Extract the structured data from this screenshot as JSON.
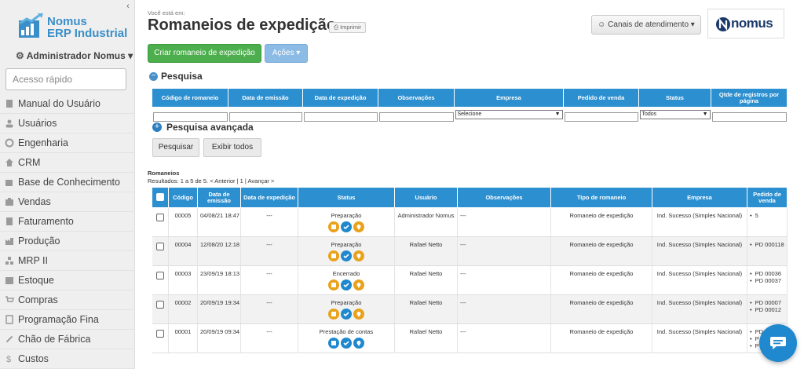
{
  "sidebar": {
    "brand_line1": "Nomus",
    "brand_line2": "ERP Industrial",
    "user_label": "Administrador Nomus",
    "quick_access_placeholder": "Acesso rápido",
    "items": [
      {
        "label": "Manual do Usuário",
        "icon": "book-icon"
      },
      {
        "label": "Usuários",
        "icon": "user-icon"
      },
      {
        "label": "Engenharia",
        "icon": "gear-icon"
      },
      {
        "label": "CRM",
        "icon": "home-icon"
      },
      {
        "label": "Base de Conhecimento",
        "icon": "edit-icon"
      },
      {
        "label": "Vendas",
        "icon": "sales-icon"
      },
      {
        "label": "Faturamento",
        "icon": "invoice-icon"
      },
      {
        "label": "Produção",
        "icon": "factory-icon"
      },
      {
        "label": "MRP II",
        "icon": "network-icon"
      },
      {
        "label": "Estoque",
        "icon": "box-icon"
      },
      {
        "label": "Compras",
        "icon": "cart-icon"
      },
      {
        "label": "Programação Fina",
        "icon": "doc-icon"
      },
      {
        "label": "Chão de Fábrica",
        "icon": "wrench-icon"
      },
      {
        "label": "Custos",
        "icon": "dollar-icon"
      }
    ]
  },
  "header": {
    "breadcrumb": "Você está em:",
    "title": "Romaneios de expedição",
    "print_label": "Imprimir",
    "channels_label": "Canais de atendimento",
    "logo_text": "nomus"
  },
  "toolbar": {
    "create_label": "Criar romaneio de expedição",
    "actions_label": "Ações"
  },
  "search": {
    "section_title": "Pesquisa",
    "columns": [
      "Código de romaneio",
      "Data de emissão",
      "Data de expedição",
      "Observações",
      "Empresa",
      "Pedido de venda",
      "Status",
      "Qtde de registros por página"
    ],
    "empresa_selected": "Selecione",
    "status_selected": "Todos",
    "advanced_label": "Pesquisa avançada",
    "search_button": "Pesquisar",
    "show_all_button": "Exibir todos"
  },
  "results": {
    "title": "Romaneios",
    "info_prefix": "Resultados: 1 a 5 de 5.",
    "prev_label": "< Anterior",
    "page_label": "1",
    "next_label": "Avançar >",
    "columns": [
      "Código",
      "Data de emissão",
      "Data de expedição",
      "Status",
      "Usuário",
      "Observações",
      "Tipo de romaneio",
      "Empresa",
      "Pedido de venda"
    ],
    "rows": [
      {
        "code": "00005",
        "issued": "04/08/21 18:47",
        "shipped": "---",
        "status": "Preparação",
        "user": "Administrador Nomus",
        "notes": "---",
        "type": "Romaneio de expedição",
        "company": "Ind. Sucesso (Simples Nacional)",
        "orders": [
          "5"
        ],
        "icons": [
          "orange",
          "blue",
          "orange"
        ]
      },
      {
        "code": "00004",
        "issued": "12/08/20 12:18",
        "shipped": "---",
        "status": "Preparação",
        "user": "Rafael Netto",
        "notes": "---",
        "type": "Romaneio de expedição",
        "company": "Ind. Sucesso (Simples Nacional)",
        "orders": [
          "PD 000118"
        ],
        "icons": [
          "orange",
          "blue",
          "orange"
        ]
      },
      {
        "code": "00003",
        "issued": "23/09/19 18:13",
        "shipped": "---",
        "status": "Encerrado",
        "user": "Rafael Netto",
        "notes": "---",
        "type": "Romaneio de expedição",
        "company": "Ind. Sucesso (Simples Nacional)",
        "orders": [
          "PD 00036",
          "PD 00037"
        ],
        "icons": [
          "orange",
          "blue",
          "orange"
        ]
      },
      {
        "code": "00002",
        "issued": "20/09/19 19:34",
        "shipped": "---",
        "status": "Preparação",
        "user": "Rafael Netto",
        "notes": "---",
        "type": "Romaneio de expedição",
        "company": "Ind. Sucesso (Simples Nacional)",
        "orders": [
          "PD 00007",
          "PD 00012"
        ],
        "icons": [
          "orange",
          "blue",
          "orange"
        ]
      },
      {
        "code": "00001",
        "issued": "20/09/19 09:34",
        "shipped": "---",
        "status": "Prestação de contas",
        "user": "Rafael Netto",
        "notes": "---",
        "type": "Romaneio de expedição",
        "company": "Ind. Sucesso (Simples Nacional)",
        "orders": [
          "PD",
          "P",
          "P"
        ],
        "icons": [
          "blue",
          "blue",
          "blue"
        ]
      }
    ]
  },
  "colors": {
    "primary": "#2c8fd0",
    "success": "#4cae4c",
    "warning": "#e8a21c"
  }
}
